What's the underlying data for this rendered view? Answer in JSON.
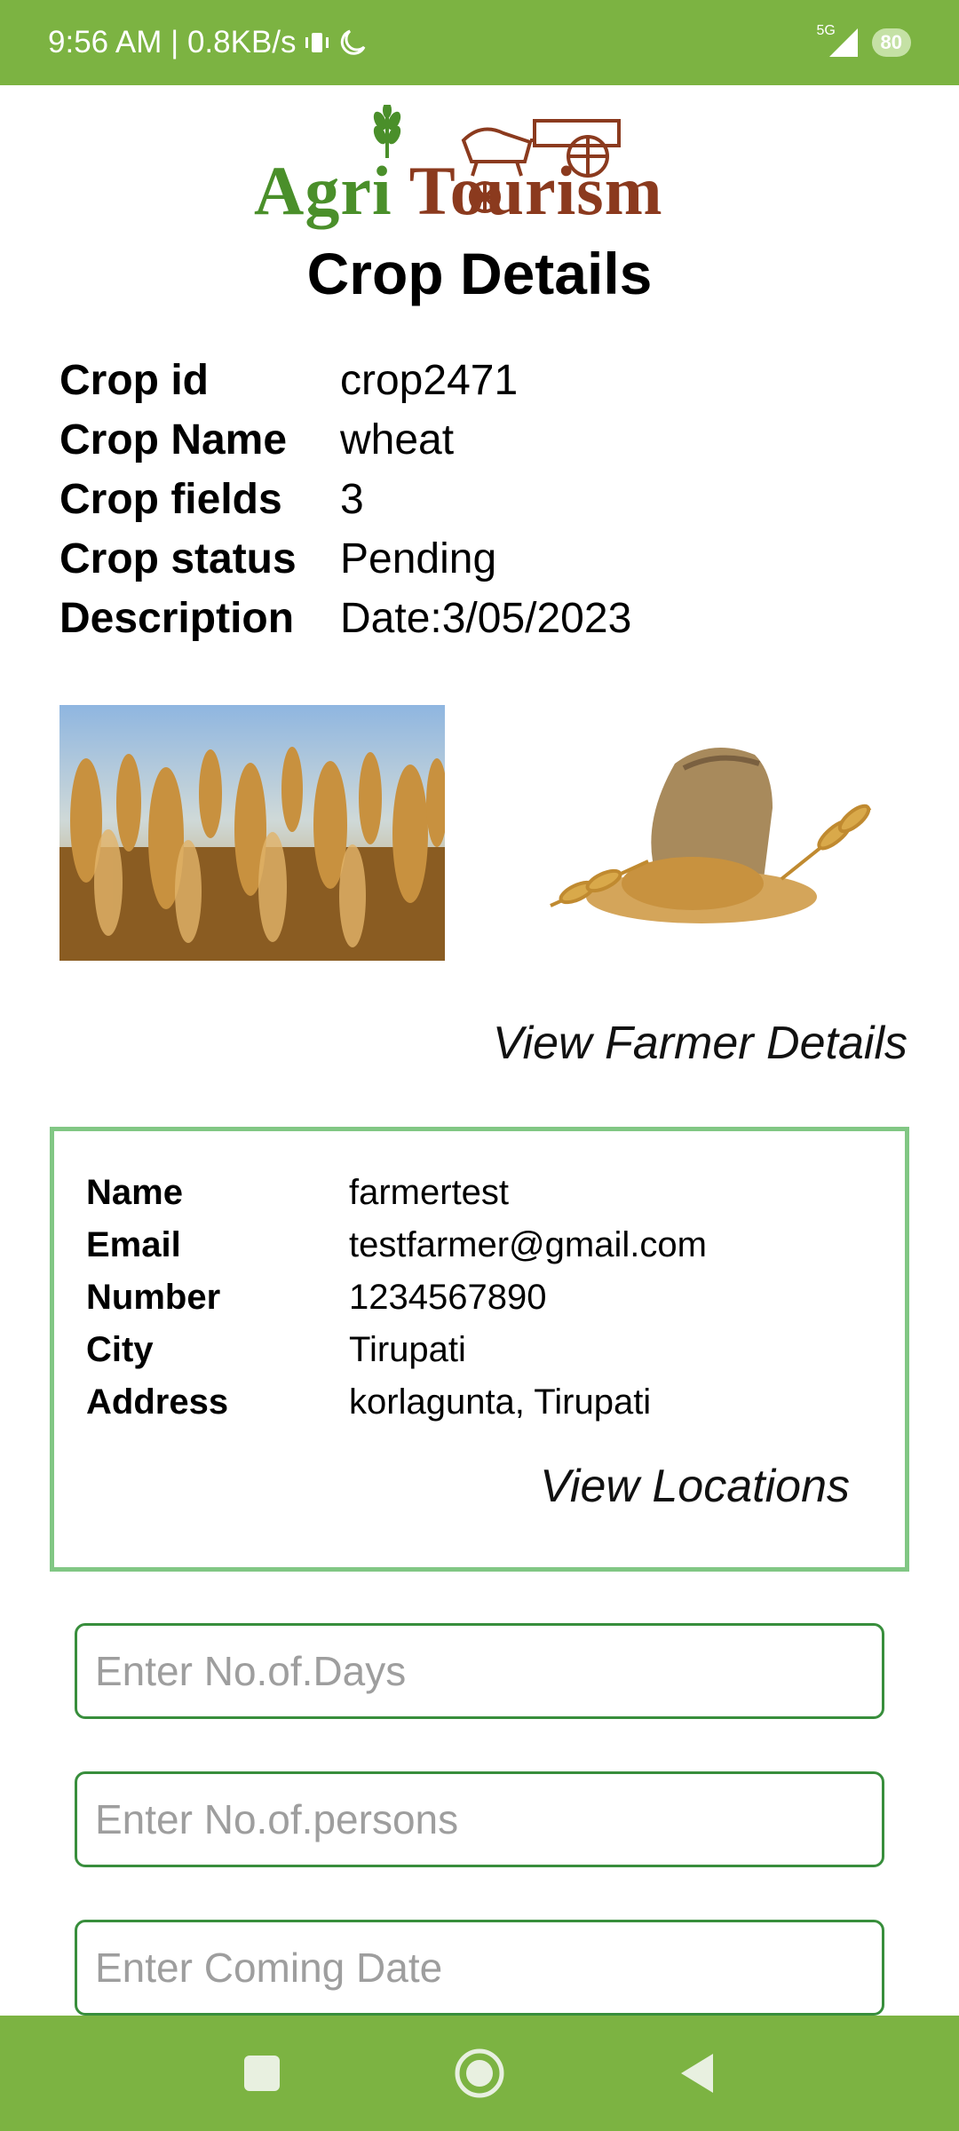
{
  "status_bar": {
    "time_speed": "9:56 AM | 0.8KB/s",
    "network": "5G",
    "battery": "80",
    "icons": [
      "vibrate-icon",
      "moon-icon",
      "signal-icon",
      "battery-icon"
    ]
  },
  "header": {
    "logo_word1": "Agri",
    "logo_word2": "Tourism",
    "title": "Crop Details"
  },
  "crop": {
    "rows": [
      {
        "label": "Crop id",
        "value": "crop2471"
      },
      {
        "label": "Crop Name",
        "value": "wheat"
      },
      {
        "label": "Crop fields",
        "value": "3"
      },
      {
        "label": "Crop status",
        "value": "Pending"
      },
      {
        "label": "Description",
        "value": "Date:3/05/2023"
      }
    ],
    "images": [
      "wheat-field-image",
      "grain-sack-image"
    ]
  },
  "links": {
    "view_farmer": "View Farmer Details",
    "view_locations": "View Locations"
  },
  "farmer": {
    "rows": [
      {
        "label": "Name",
        "value": "farmertest"
      },
      {
        "label": "Email",
        "value": "testfarmer@gmail.com"
      },
      {
        "label": "Number",
        "value": "1234567890"
      },
      {
        "label": "City",
        "value": "Tirupati"
      },
      {
        "label": "Address",
        "value": "korlagunta, Tirupati"
      }
    ]
  },
  "form": {
    "days_placeholder": "Enter No.of.Days",
    "persons_placeholder": "Enter No.of.persons",
    "date_placeholder": "Enter Coming Date"
  },
  "colors": {
    "bar_green": "#7cb342",
    "card_border": "#81c784",
    "input_border": "#388e3c",
    "logo_green": "#4a8f2a",
    "logo_brown": "#8b3a1e"
  },
  "nav": {
    "icons": [
      "recents-square-icon",
      "home-circle-icon",
      "back-triangle-icon"
    ]
  }
}
